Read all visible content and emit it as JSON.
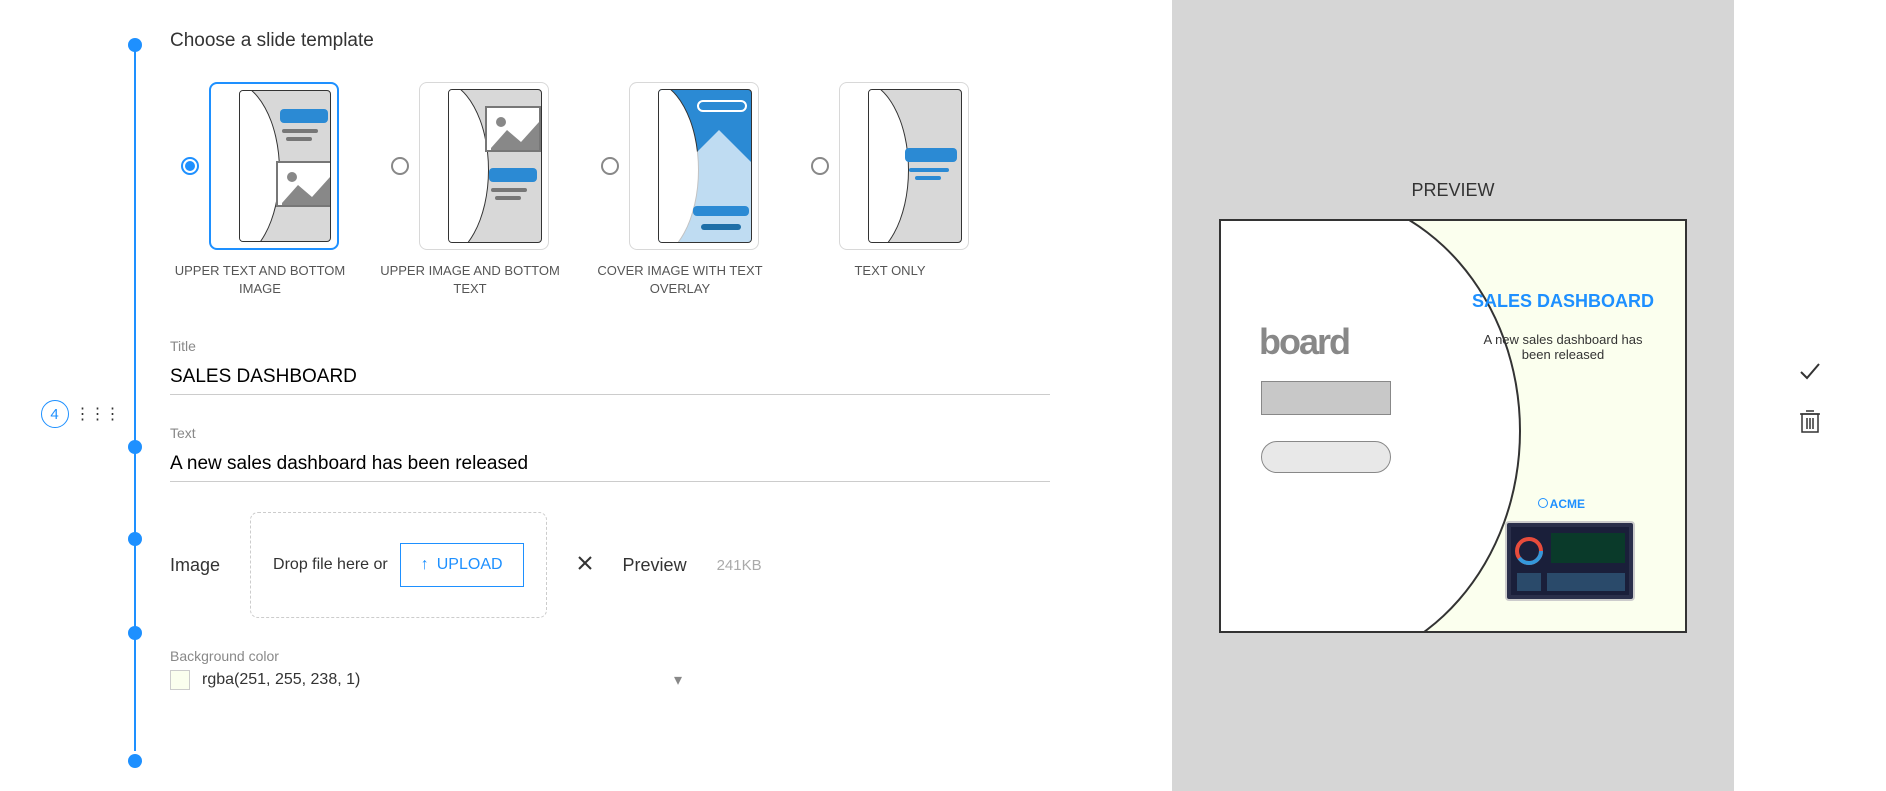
{
  "step": "4",
  "chooseLabel": "Choose a slide template",
  "templates": [
    {
      "label": "UPPER TEXT AND BOTTOM IMAGE",
      "selected": true
    },
    {
      "label": "UPPER IMAGE AND BOTTOM TEXT",
      "selected": false
    },
    {
      "label": "COVER IMAGE WITH TEXT OVERLAY",
      "selected": false
    },
    {
      "label": "TEXT ONLY",
      "selected": false
    }
  ],
  "title": {
    "label": "Title",
    "value": "SALES DASHBOARD"
  },
  "text": {
    "label": "Text",
    "value": "A new sales dashboard has been released"
  },
  "image": {
    "label": "Image",
    "dropHint": "Drop file here or",
    "uploadBtn": "UPLOAD",
    "previewLabel": "Preview",
    "sizeText": "241KB"
  },
  "bgColor": {
    "label": "Background color",
    "value": "rgba(251, 255, 238, 1)",
    "swatch": "#fbffee"
  },
  "preview": {
    "heading": "PREVIEW",
    "title": "SALES DASHBOARD",
    "text": "A new sales dashboard has been released",
    "logoText": "board",
    "brandText": "ACME"
  }
}
